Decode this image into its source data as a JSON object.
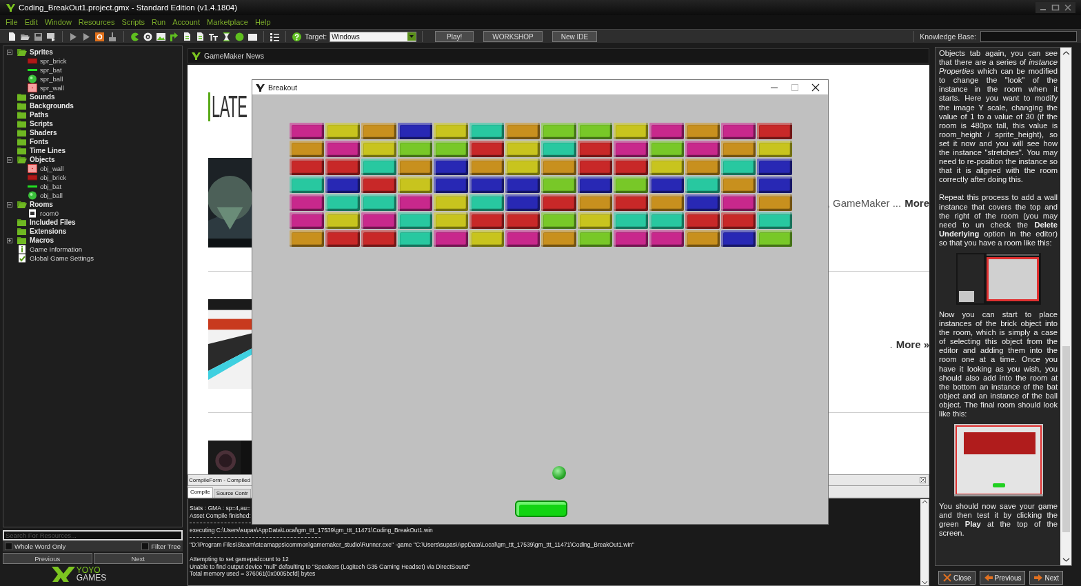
{
  "window": {
    "title": "Coding_BreakOut1.project.gmx  -  Standard Edition (v1.4.1804)"
  },
  "menu": [
    "File",
    "Edit",
    "Window",
    "Resources",
    "Scripts",
    "Run",
    "Account",
    "Marketplace",
    "Help"
  ],
  "toolbar": {
    "target_label": "Target:",
    "target_value": "Windows",
    "buttons": [
      "Play!",
      "WORKSHOP",
      "New IDE"
    ],
    "knowledge_label": "Knowledge Base:"
  },
  "resources": {
    "tree": [
      {
        "label": "Sprites",
        "kind": "folder",
        "expanded": true,
        "children": [
          {
            "label": "spr_brick",
            "kind": "brick"
          },
          {
            "label": "spr_bat",
            "kind": "bat"
          },
          {
            "label": "spr_ball",
            "kind": "ball"
          },
          {
            "label": "spr_wall",
            "kind": "wall"
          }
        ]
      },
      {
        "label": "Sounds",
        "kind": "empty_folder",
        "expanded": false
      },
      {
        "label": "Backgrounds",
        "kind": "empty_folder",
        "expanded": false
      },
      {
        "label": "Paths",
        "kind": "empty_folder",
        "expanded": false
      },
      {
        "label": "Scripts",
        "kind": "empty_folder",
        "expanded": false
      },
      {
        "label": "Shaders",
        "kind": "empty_folder",
        "expanded": false
      },
      {
        "label": "Fonts",
        "kind": "empty_folder",
        "expanded": false
      },
      {
        "label": "Time Lines",
        "kind": "empty_folder",
        "expanded": false
      },
      {
        "label": "Objects",
        "kind": "folder",
        "expanded": true,
        "children": [
          {
            "label": "obj_wall",
            "kind": "wall"
          },
          {
            "label": "obj_brick",
            "kind": "brick"
          },
          {
            "label": "obj_bat",
            "kind": "bat"
          },
          {
            "label": "obj_ball",
            "kind": "ball"
          }
        ]
      },
      {
        "label": "Rooms",
        "kind": "folder",
        "expanded": true,
        "children": [
          {
            "label": "room0",
            "kind": "room"
          }
        ]
      },
      {
        "label": "Included Files",
        "kind": "empty_folder",
        "expanded": false
      },
      {
        "label": "Extensions",
        "kind": "empty_folder",
        "expanded": false
      },
      {
        "label": "Macros",
        "kind": "folder",
        "expanded": false
      },
      {
        "label": "Game Information",
        "kind": "info"
      },
      {
        "label": "Global Game Settings",
        "kind": "settings"
      }
    ],
    "search": {
      "placeholder": "Search For Resources..."
    },
    "options": [
      {
        "label": "Whole Word Only",
        "checked": false
      },
      {
        "label": "Filter Tree",
        "checked": false
      }
    ],
    "buttons": [
      "Previous",
      "Next"
    ],
    "logo": [
      "YOYO",
      "GAMES"
    ]
  },
  "news": {
    "tab": "GameMaker News",
    "heading": "LATE",
    "items": [
      {
        "kind": "picture",
        "snippet": ", GameMaker ...",
        "link": "More"
      },
      {
        "kind": "picture",
        "snippet": ".",
        "link": "More »"
      },
      {
        "kind": "picture"
      }
    ]
  },
  "compile": {
    "title": "CompileForm - Compiled",
    "tabs": [
      {
        "label": "Compile",
        "selected": true
      },
      {
        "label": "Source Contr",
        "selected": false
      }
    ],
    "log": [
      {
        "kind": "text",
        "text": "Stats : GMA : sp=4,au="
      },
      {
        "kind": "text",
        "text": "Asset Compile finished:"
      },
      {
        "kind": "rule"
      },
      {
        "kind": "text",
        "text": "executing C:\\Users\\supas\\AppData\\Local\\gm_ttt_17539\\gm_ttt_11471\\Coding_BreakOut1.win"
      },
      {
        "kind": "rule"
      },
      {
        "kind": "text",
        "text": "\"D:\\Program Files\\Steam\\steamapps\\common\\gamemaker_studio\\Runner.exe\"  -game \"C:\\Users\\supas\\AppData\\Local\\gm_ttt_17539\\gm_ttt_11471\\Coding_BreakOut1.win\""
      },
      {
        "kind": "gap"
      },
      {
        "kind": "text",
        "text": "Attempting to set gamepadcount to 12"
      },
      {
        "kind": "text",
        "text": "Unable to find output device \"null\" defaulting to \"Speakers (Logitech G35 Gaming Headset) via DirectSound\""
      },
      {
        "kind": "text",
        "text": "Total memory used = 376061(0x0005bcfd) bytes"
      }
    ]
  },
  "game": {
    "title": "Breakout",
    "brick_rows": [
      {
        "bricks": [
          {
            "color": "#c8288c"
          },
          {
            "color": "#c8c41e"
          },
          {
            "color": "#c8901e"
          },
          {
            "color": "#2828b4"
          },
          {
            "color": "#c8c41e"
          },
          {
            "color": "#28c8a0"
          },
          {
            "color": "#c8901e"
          },
          {
            "color": "#78c828"
          },
          {
            "color": "#78c828"
          },
          {
            "color": "#c8c41e"
          },
          {
            "color": "#c8288c"
          },
          {
            "color": "#c8901e"
          },
          {
            "color": "#c8288c"
          },
          {
            "color": "#c82828"
          }
        ]
      },
      {
        "bricks": [
          {
            "color": "#c8901e"
          },
          {
            "color": "#c8288c"
          },
          {
            "color": "#c8c41e"
          },
          {
            "color": "#78c828"
          },
          {
            "color": "#78c828"
          },
          {
            "color": "#c82828"
          },
          {
            "color": "#c8c41e"
          },
          {
            "color": "#28c8a0"
          },
          {
            "color": "#c82828"
          },
          {
            "color": "#c8288c"
          },
          {
            "color": "#78c828"
          },
          {
            "color": "#c8288c"
          },
          {
            "color": "#c8901e"
          },
          {
            "color": "#c8c41e"
          }
        ]
      },
      {
        "bricks": [
          {
            "color": "#c82828"
          },
          {
            "color": "#c82828"
          },
          {
            "color": "#28c8a0"
          },
          {
            "color": "#c8901e"
          },
          {
            "color": "#2828b4"
          },
          {
            "color": "#c8901e"
          },
          {
            "color": "#c8c41e"
          },
          {
            "color": "#c8901e"
          },
          {
            "color": "#c82828"
          },
          {
            "color": "#c82828"
          },
          {
            "color": "#c8c41e"
          },
          {
            "color": "#c8901e"
          },
          {
            "color": "#28c8a0"
          },
          {
            "color": "#2828b4"
          }
        ]
      },
      {
        "bricks": [
          {
            "color": "#28c8a0"
          },
          {
            "color": "#2828b4"
          },
          {
            "color": "#c82828"
          },
          {
            "color": "#c8c41e"
          },
          {
            "color": "#2828b4"
          },
          {
            "color": "#2828b4"
          },
          {
            "color": "#2828b4"
          },
          {
            "color": "#78c828"
          },
          {
            "color": "#2828b4"
          },
          {
            "color": "#78c828"
          },
          {
            "color": "#2828b4"
          },
          {
            "color": "#28c8a0"
          },
          {
            "color": "#c8901e"
          },
          {
            "color": "#2828b4"
          }
        ]
      },
      {
        "bricks": [
          {
            "color": "#c8288c"
          },
          {
            "color": "#28c8a0"
          },
          {
            "color": "#28c8a0"
          },
          {
            "color": "#c8288c"
          },
          {
            "color": "#c8c41e"
          },
          {
            "color": "#28c8a0"
          },
          {
            "color": "#2828b4"
          },
          {
            "color": "#c82828"
          },
          {
            "color": "#c8901e"
          },
          {
            "color": "#c82828"
          },
          {
            "color": "#c8901e"
          },
          {
            "color": "#2828b4"
          },
          {
            "color": "#c8288c"
          },
          {
            "color": "#c8901e"
          }
        ]
      },
      {
        "bricks": [
          {
            "color": "#c8288c"
          },
          {
            "color": "#c8c41e"
          },
          {
            "color": "#c8288c"
          },
          {
            "color": "#28c8a0"
          },
          {
            "color": "#c8c41e"
          },
          {
            "color": "#c82828"
          },
          {
            "color": "#c82828"
          },
          {
            "color": "#78c828"
          },
          {
            "color": "#c8c41e"
          },
          {
            "color": "#28c8a0"
          },
          {
            "color": "#28c8a0"
          },
          {
            "color": "#c82828"
          },
          {
            "color": "#c82828"
          },
          {
            "color": "#28c8a0"
          }
        ]
      },
      {
        "bricks": [
          {
            "color": "#c8901e"
          },
          {
            "color": "#c82828"
          },
          {
            "color": "#c82828"
          },
          {
            "color": "#28c8a0"
          },
          {
            "color": "#c8288c"
          },
          {
            "color": "#c8c41e"
          },
          {
            "color": "#c8288c"
          },
          {
            "color": "#c8901e"
          },
          {
            "color": "#78c828"
          },
          {
            "color": "#c8288c"
          },
          {
            "color": "#c8288c"
          },
          {
            "color": "#c8901e"
          },
          {
            "color": "#2828b4"
          },
          {
            "color": "#78c828"
          }
        ]
      }
    ]
  },
  "help": {
    "blocks": [
      {
        "kind": "text",
        "text": "Objects tab again, you can see that there are a series of *instance Properties* which can be modified to change the \"look\" of the instance in the room when it starts. Here you want to modify the image Y scale, changing the value of 1 to a value of 30 (if the room is 480px tall, this value is room_height / sprite_height), so set it now and you will see how the instance \"stretches\". You may need to re-position the instance so that it is aligned with the room correctly after doing this."
      },
      {
        "kind": "text",
        "text": "Repeat this process to add a wall instance that covers the top and the right of the room (you may need to un check the **Delete Underlying** option in the editor) so that you have a room like this:"
      },
      {
        "kind": "picture"
      },
      {
        "kind": "text",
        "text": "Now you can start to place instances of the brick object into the room, which is simply a case of selecting this object from the editor and adding them into the room one at a time. Once you have it looking as you wish, you should also add into the room at the bottom an instance of the bat object and an instance of the ball object. The final room should look like this:"
      },
      {
        "kind": "picture"
      },
      {
        "kind": "text",
        "text": "You should now save your game and then test it by clicking the green **Play** at the top of the screen."
      }
    ],
    "buttons": [
      {
        "kind": "close",
        "label": "Close"
      },
      {
        "kind": "previous",
        "label": "Previous"
      },
      {
        "kind": "next",
        "label": "Next"
      }
    ]
  }
}
